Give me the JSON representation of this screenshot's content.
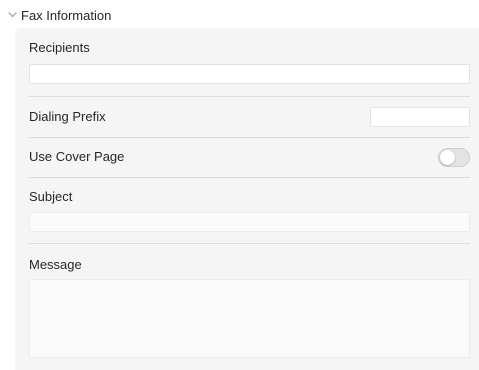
{
  "section": {
    "title": "Fax Information",
    "expanded": true,
    "chevron_icon": "chevron-down-icon"
  },
  "fields": {
    "recipients": {
      "label": "Recipients",
      "value": "",
      "placeholder": ""
    },
    "dialing_prefix": {
      "label": "Dialing Prefix",
      "value": "",
      "placeholder": ""
    },
    "use_cover_page": {
      "label": "Use Cover Page",
      "on": false
    },
    "subject": {
      "label": "Subject",
      "value": "",
      "placeholder": ""
    },
    "message": {
      "label": "Message",
      "value": "",
      "placeholder": ""
    }
  },
  "colors": {
    "panel_bg": "#f5f5f5",
    "divider": "#dddddd",
    "toggle_off": "#e3e3e3"
  }
}
